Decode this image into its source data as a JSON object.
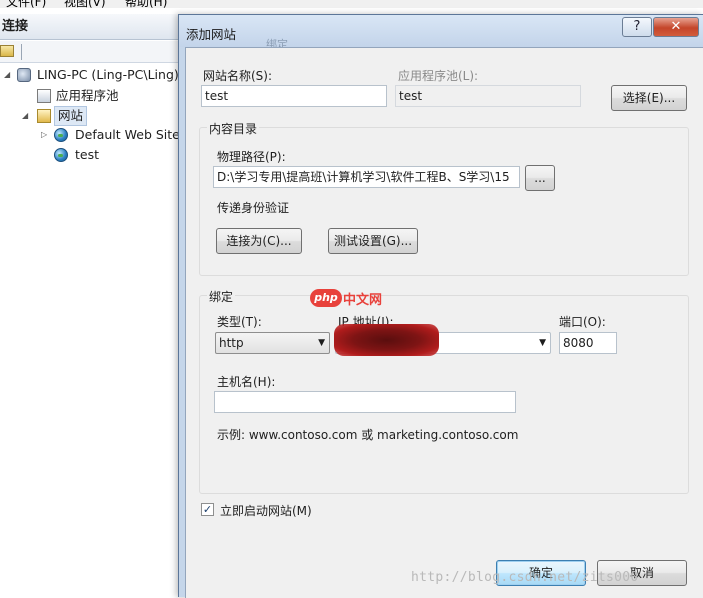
{
  "menubar": {
    "items": [
      "文件(F)",
      "视图(V)",
      "帮助(H)"
    ]
  },
  "connections": {
    "header": "连接",
    "tree": {
      "server": "LING-PC (Ling-PC\\Ling)",
      "app_pools": "应用程序池",
      "sites": "网站",
      "default_site": "Default Web Site",
      "test_site": "test"
    }
  },
  "dialog": {
    "title": "添加网站",
    "title_ghost": "绑定",
    "help": "?",
    "close": "✕",
    "site_name_label": "网站名称(S):",
    "site_name_value": "test",
    "app_pool_label": "应用程序池(L):",
    "app_pool_value": "test",
    "select_button": "选择(E)...",
    "content_group": "内容目录",
    "physical_path_label": "物理路径(P):",
    "physical_path_value": "D:\\学习专用\\提高班\\计算机学习\\软件工程B、S学习\\15",
    "browse_button": "...",
    "pass_through_label": "传递身份验证",
    "connect_as_button": "连接为(C)...",
    "test_settings_button": "测试设置(G)...",
    "binding_group": "绑定",
    "type_label": "类型(T):",
    "type_value": "http",
    "ip_label": "IP 地址(I):",
    "ip_value": "",
    "port_label": "端口(O):",
    "port_value": "8080",
    "host_label": "主机名(H):",
    "host_value": "",
    "example_text": "示例: www.contoso.com 或 marketing.contoso.com",
    "start_now_label": "立即启动网站(M)",
    "start_now_checked": true,
    "ok_button": "确定",
    "cancel_button": "取消"
  },
  "watermarks": {
    "logo_badge": "php",
    "logo_text": "中文网",
    "url": "http://blog.csdn.net/zits000"
  },
  "colors": {
    "titlebar": "#c5d6ea",
    "client": "#f0f0f0",
    "default_button_border": "#3c7fb1",
    "close_button": "#c4452a"
  }
}
